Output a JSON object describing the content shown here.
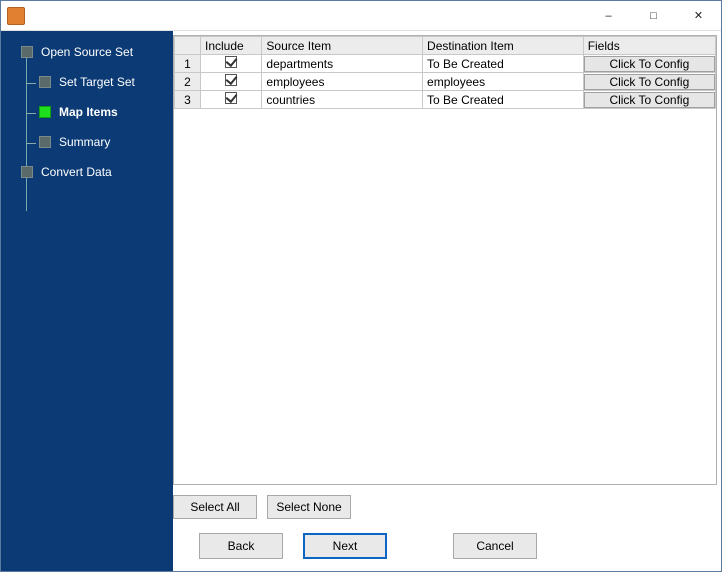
{
  "window": {
    "title": ""
  },
  "sidebar": {
    "steps": [
      {
        "label": "Open Source Set",
        "level": 0,
        "active": false
      },
      {
        "label": "Set Target Set",
        "level": 1,
        "active": false
      },
      {
        "label": "Map Items",
        "level": 1,
        "active": true
      },
      {
        "label": "Summary",
        "level": 1,
        "active": false
      },
      {
        "label": "Convert Data",
        "level": 0,
        "active": false
      }
    ]
  },
  "table": {
    "headers": {
      "rownum": "",
      "include": "Include",
      "source": "Source Item",
      "destination": "Destination Item",
      "fields": "Fields"
    },
    "rows": [
      {
        "n": "1",
        "include": true,
        "source": "departments",
        "destination": "To Be Created",
        "fields": "Click To Config"
      },
      {
        "n": "2",
        "include": true,
        "source": "employees",
        "destination": "employees",
        "fields": "Click To Config"
      },
      {
        "n": "3",
        "include": true,
        "source": "countries",
        "destination": "To Be Created",
        "fields": "Click To Config"
      }
    ]
  },
  "buttons": {
    "select_all": "Select All",
    "select_none": "Select None",
    "back": "Back",
    "next": "Next",
    "cancel": "Cancel"
  }
}
